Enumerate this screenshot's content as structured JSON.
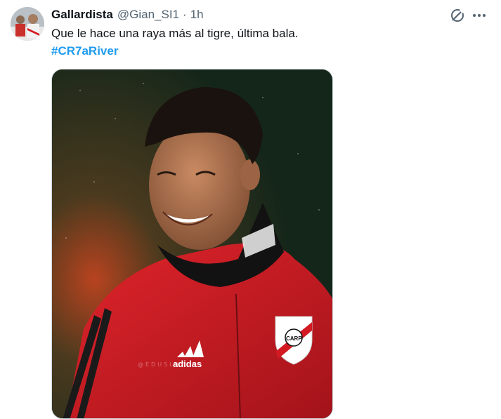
{
  "tweet": {
    "display_name": "Gallardista",
    "handle": "@Gian_SI1",
    "separator": "·",
    "time": "1h",
    "text": "Que le hace una raya más al tigre, última bala.",
    "hashtag": "#CR7aRiver"
  },
  "icons": {
    "grok": "grok-icon",
    "more": "more-icon"
  },
  "media": {
    "jacket_brand": "adidas",
    "crest_letters": "CARP",
    "watermark": "@EDUSLUZUY"
  },
  "colors": {
    "hashtag": "#1d9bf0",
    "secondary_text": "#536471",
    "jacket_red": "#d31a22"
  }
}
